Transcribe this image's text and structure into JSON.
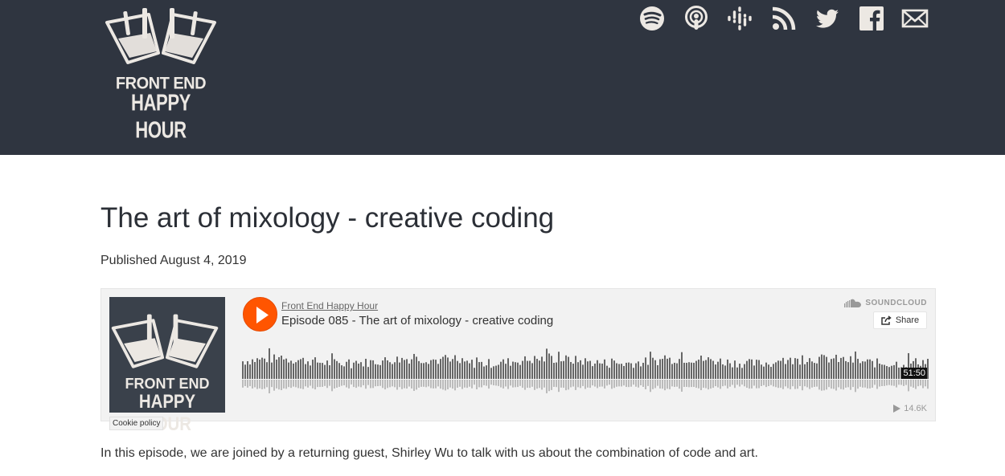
{
  "header": {
    "logo": {
      "line1": "FRONT END",
      "line2": "HAPPY HOUR"
    },
    "social": [
      {
        "name": "spotify-icon"
      },
      {
        "name": "apple-podcasts-icon"
      },
      {
        "name": "google-podcasts-icon"
      },
      {
        "name": "rss-icon"
      },
      {
        "name": "twitter-icon"
      },
      {
        "name": "facebook-icon"
      },
      {
        "name": "email-icon"
      }
    ],
    "colors": {
      "background": "#2f3540",
      "icon": "#ece8e3"
    }
  },
  "post": {
    "title": "The art of mixology - creative coding",
    "published": "Published August 4, 2019",
    "description": "In this episode, we are joined by a returning guest, Shirley Wu to talk with us about the combination of code and art."
  },
  "player": {
    "artwork": {
      "line1": "FRONT END",
      "line2": "HAPPY HOUR"
    },
    "cookie_policy": "Cookie policy",
    "artist": "Front End Happy Hour",
    "track": "Episode 085 - The art of mixology - creative coding",
    "brand": "SOUNDCLOUD",
    "share_label": "Share",
    "duration": "51:50",
    "plays": "14.6K",
    "colors": {
      "accent": "#ff5500",
      "waveform": "#666666"
    }
  }
}
